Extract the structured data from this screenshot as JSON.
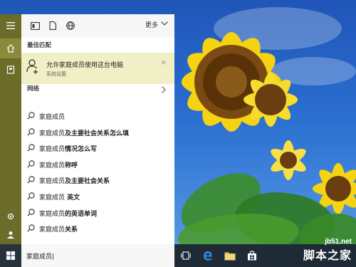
{
  "search": {
    "query": "家庭成员"
  },
  "topbar": {
    "more_label": "更多"
  },
  "best_match": {
    "section_title": "最佳匹配",
    "title": "允许家庭成员使用这台电脑",
    "subtitle": "系统设置"
  },
  "web": {
    "section_title": "网络",
    "suggestions": [
      {
        "prefix": "家庭成员",
        "suffix": ""
      },
      {
        "prefix": "家庭成员",
        "suffix": "及主要社会关系怎么填"
      },
      {
        "prefix": "家庭成员",
        "suffix": "情况怎么写"
      },
      {
        "prefix": "家庭成员",
        "suffix": "称呼"
      },
      {
        "prefix": "家庭成员",
        "suffix": "及主要社会关系"
      },
      {
        "prefix": "家庭成员",
        "suffix": " 英文"
      },
      {
        "prefix": "家庭成员",
        "suffix": "的英语单词"
      },
      {
        "prefix": "家庭成员",
        "suffix": "关系"
      }
    ]
  },
  "watermark": {
    "url": "jb51.net",
    "name": "脚本之家"
  },
  "colors": {
    "left_strip": "#6b6b2a",
    "best_match_bg": "#f0efc6",
    "taskbar": "#1e2a36"
  }
}
